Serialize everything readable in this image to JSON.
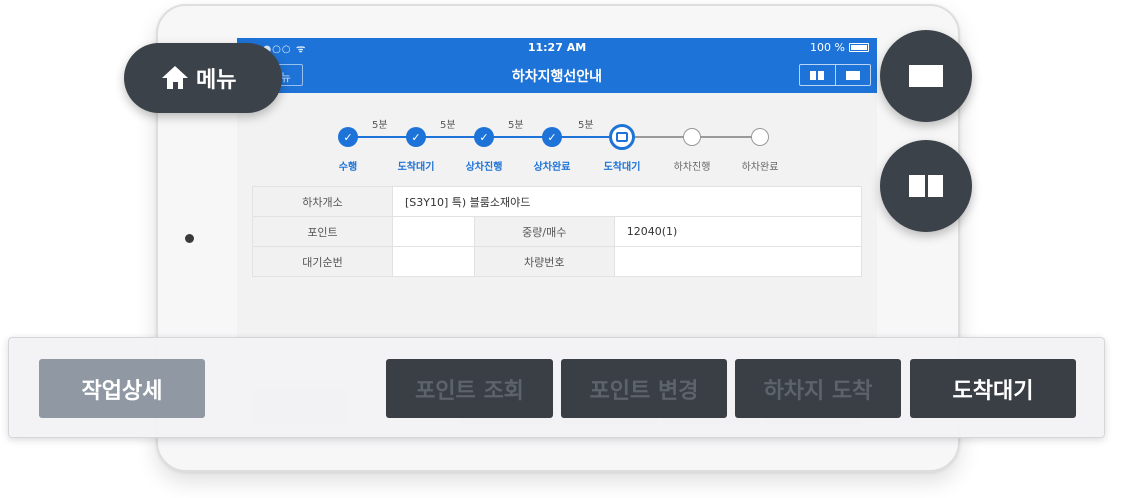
{
  "status_bar": {
    "signal": "●●●○○ ᯤ",
    "time": "11:27 AM",
    "battery": "100 %"
  },
  "nav": {
    "title": "하차지행선안내",
    "left_button": "≡ 메뉴"
  },
  "steps": [
    {
      "label": "수행",
      "time": "",
      "state": "done"
    },
    {
      "label": "도착대기",
      "time": "5분",
      "state": "done"
    },
    {
      "label": "상차진행",
      "time": "5분",
      "state": "done"
    },
    {
      "label": "상차완료",
      "time": "5분",
      "state": "done"
    },
    {
      "label": "도착대기",
      "time": "5분",
      "state": "active"
    },
    {
      "label": "하차진행",
      "time": "",
      "state": "pending"
    },
    {
      "label": "하차완료",
      "time": "",
      "state": "pending"
    }
  ],
  "info": {
    "unload_site_label": "하차개소",
    "unload_site_value": "[S3Y10] 특) 블룸소재야드",
    "point_label": "포인트",
    "point_value": "",
    "weight_label": "중량/매수",
    "weight_value": "12040(1)",
    "wait_label": "대기순번",
    "wait_value": "",
    "vehicle_label": "차량번호",
    "vehicle_value": ""
  },
  "home_menu": {
    "label": "메뉴",
    "icon": "home-icon"
  },
  "view_buttons": {
    "single": "single-view-icon",
    "split": "split-view-icon"
  },
  "actions": {
    "detail": "작업상세",
    "point_search": "포인트 조회",
    "point_change": "포인트 변경",
    "unload_arrive": "하차지 도착",
    "arrive_wait": "도착대기"
  },
  "colors": {
    "primary": "#1e73d8",
    "dark": "#3c4249",
    "detail": "#8f98a3"
  }
}
